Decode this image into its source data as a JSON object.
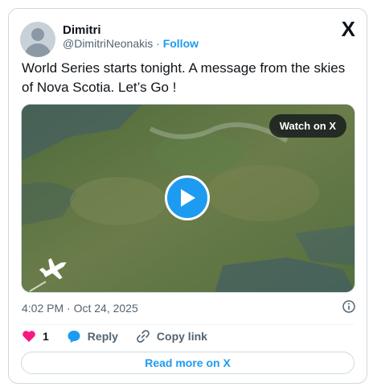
{
  "author": {
    "name": "Dimitri",
    "handle": "@DimitriNeonakis",
    "separator": "·",
    "follow_label": "Follow"
  },
  "platform_logo": "X",
  "tweet_text": "World Series starts tonight. A message from the skies of Nova Scotia.  Let’s Go !",
  "media": {
    "watch_label": "Watch on X",
    "play_icon": "play-icon",
    "airplane_icon": "airplane-icon"
  },
  "timestamp": "4:02 PM · Oct 24, 2025",
  "actions": {
    "like_count": "1",
    "reply_label": "Reply",
    "copy_link_label": "Copy link"
  },
  "read_more_label": "Read more on X",
  "colors": {
    "accent": "#1d9bf0",
    "like": "#f91880",
    "text": "#0f1419",
    "muted": "#536471"
  }
}
